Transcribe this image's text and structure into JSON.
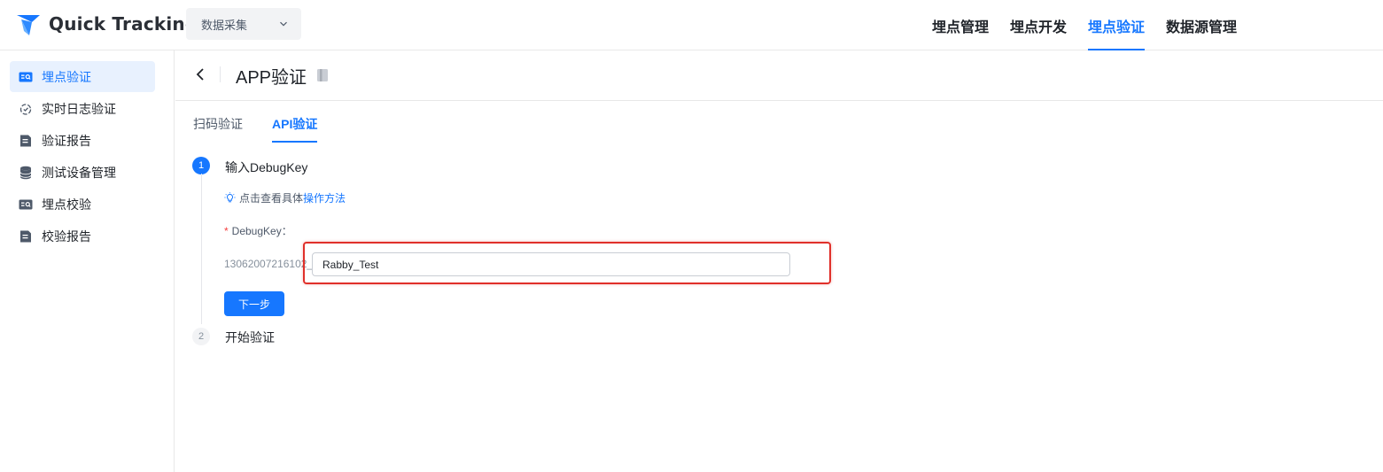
{
  "app": {
    "title": "Quick Tracking",
    "logo_icon": "quick-tracking-logo-icon",
    "brand_color": "#1677ff"
  },
  "project_select": {
    "value": "数据采集",
    "icon": "chevron-down-icon"
  },
  "top_nav": [
    {
      "label": "埋点管理",
      "active": false
    },
    {
      "label": "埋点开发",
      "active": false
    },
    {
      "label": "埋点验证",
      "active": true
    },
    {
      "label": "数据源管理",
      "active": false
    }
  ],
  "sidebar": {
    "items": [
      {
        "label": "埋点验证",
        "icon": "card-search-icon",
        "active": true
      },
      {
        "label": "实时日志验证",
        "icon": "realtime-log-icon",
        "active": false
      },
      {
        "label": "验证报告",
        "icon": "report-icon",
        "active": false
      },
      {
        "label": "测试设备管理",
        "icon": "database-icon",
        "active": false
      },
      {
        "label": "埋点校验",
        "icon": "card-search-icon",
        "active": false
      },
      {
        "label": "校验报告",
        "icon": "report-icon",
        "active": false
      }
    ]
  },
  "header": {
    "title": "APP验证",
    "back_icon": "chevron-left-icon",
    "doc_icon": "book-icon"
  },
  "tabs": [
    {
      "label": "扫码验证",
      "active": false
    },
    {
      "label": "API验证",
      "active": true
    }
  ],
  "steps": [
    {
      "number": "1",
      "title": "输入DebugKey",
      "active": true
    },
    {
      "number": "2",
      "title": "开始验证",
      "active": false
    }
  ],
  "hint": {
    "prefix": "点击查看具体",
    "link": "操作方法",
    "icon": "lightbulb-icon"
  },
  "form": {
    "label": "DebugKey：",
    "required_mark": "*",
    "prefix": "13062007216102_",
    "value": "Rabby_Test"
  },
  "next_button": "下一步",
  "annotation_color": "#e0302a"
}
